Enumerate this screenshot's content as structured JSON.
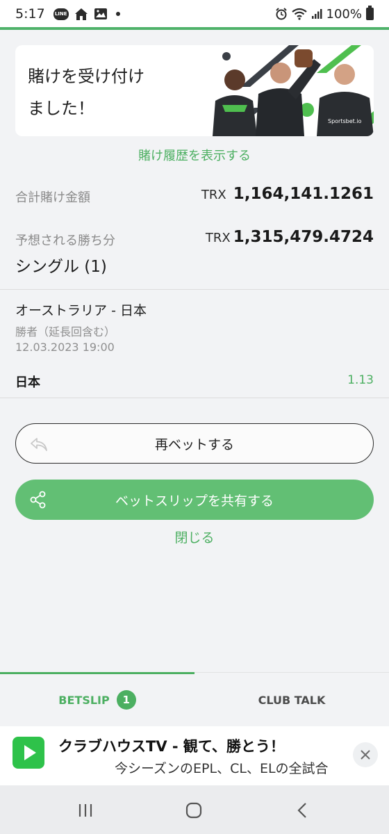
{
  "status_bar": {
    "time": "5:17",
    "battery": "100%",
    "line_label": "LINE",
    "icons": [
      "line-icon",
      "home-icon",
      "gallery-icon",
      "notification-dot",
      "alarm-icon",
      "wifi-icon",
      "signal-icon",
      "battery-icon"
    ]
  },
  "banner": {
    "title": "賭けを受け付けました！",
    "brand_text": "Sportsbet.io"
  },
  "links": {
    "view_history": "賭け履歴を表示する",
    "close": "閉じる"
  },
  "summary": {
    "total_label": "合計賭け金額",
    "total_currency": "TRX",
    "total_value": "1,164,141.1261",
    "winnings_label": "予想される勝ち分",
    "winnings_currency": "TRX",
    "winnings_value": "1,315,479.4724",
    "bet_type": "シングル (1)"
  },
  "bet": {
    "match": "オーストラリア - 日本",
    "market": "勝者（延長回含む）",
    "datetime": "12.03.2023 19:00",
    "selection": "日本",
    "odds": "1.13"
  },
  "buttons": {
    "rebet": "再ベットする",
    "share": "ベットスリップを共有する"
  },
  "tabs": {
    "betslip": "BETSLIP",
    "betslip_count": "1",
    "club_talk": "CLUB TALK",
    "active": "betslip"
  },
  "ad": {
    "title": "クラブハウスTV - 観て、勝とう！",
    "subtitle": "今シーズンのEPL、CL、ELの全試合"
  },
  "colors": {
    "accent": "#4caf61",
    "button_green": "#62bf74",
    "background": "#f2f3f5"
  }
}
